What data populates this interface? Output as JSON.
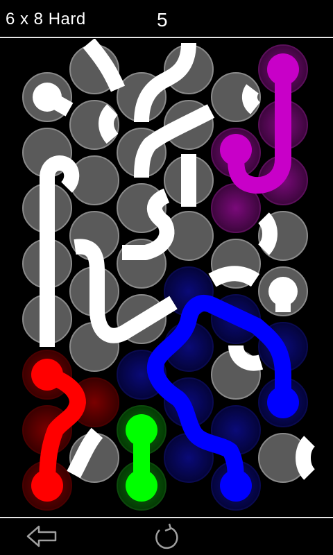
{
  "header": {
    "level_title": "6 x 8 Hard",
    "moves": "5"
  },
  "footer": {
    "back_icon": "back-arrow-icon",
    "restart_icon": "restart-icon"
  },
  "colors": {
    "background": "#000000",
    "cell": "#5a5a5a",
    "cell_border": "#8a8a8a",
    "pipe": "#ffffff",
    "red": "#ff0000",
    "green": "#00ff00",
    "blue": "#0000ff",
    "magenta": "#c800c8"
  },
  "board": {
    "grid": {
      "cols": 6,
      "rows": 8,
      "layout": "hex-offset"
    },
    "flows": [
      {
        "name": "magenta",
        "color": "#c800c8",
        "endpoints": 2
      },
      {
        "name": "red",
        "color": "#ff0000",
        "endpoints": 2
      },
      {
        "name": "green",
        "color": "#00ff00",
        "endpoints": 2
      },
      {
        "name": "blue",
        "color": "#0000ff",
        "endpoints": 3
      }
    ]
  }
}
